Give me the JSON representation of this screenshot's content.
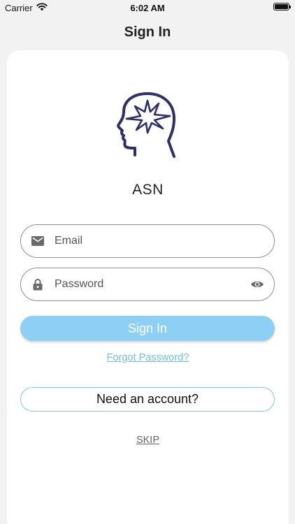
{
  "status_bar": {
    "carrier": "Carrier",
    "time": "6:02 AM",
    "icons": [
      "wifi-icon",
      "battery-icon"
    ]
  },
  "header": {
    "title": "Sign In"
  },
  "app": {
    "name": "ASN",
    "logo_icon": "brain-head-logo",
    "logo_color": "#2c2f6b"
  },
  "form": {
    "email": {
      "icon": "mail-icon",
      "placeholder": "Email",
      "value": ""
    },
    "password": {
      "icon": "lock-icon",
      "placeholder": "Password",
      "value": "",
      "toggle_icon": "eye-icon"
    },
    "signin_label": "Sign In",
    "forgot_label": "Forgot Password?",
    "need_account_label": "Need an account?",
    "skip_label": "SKIP"
  },
  "colors": {
    "accent": "#8ecff6",
    "link": "#6ec0ee",
    "background": "#f2f2f2",
    "card": "#ffffff"
  }
}
